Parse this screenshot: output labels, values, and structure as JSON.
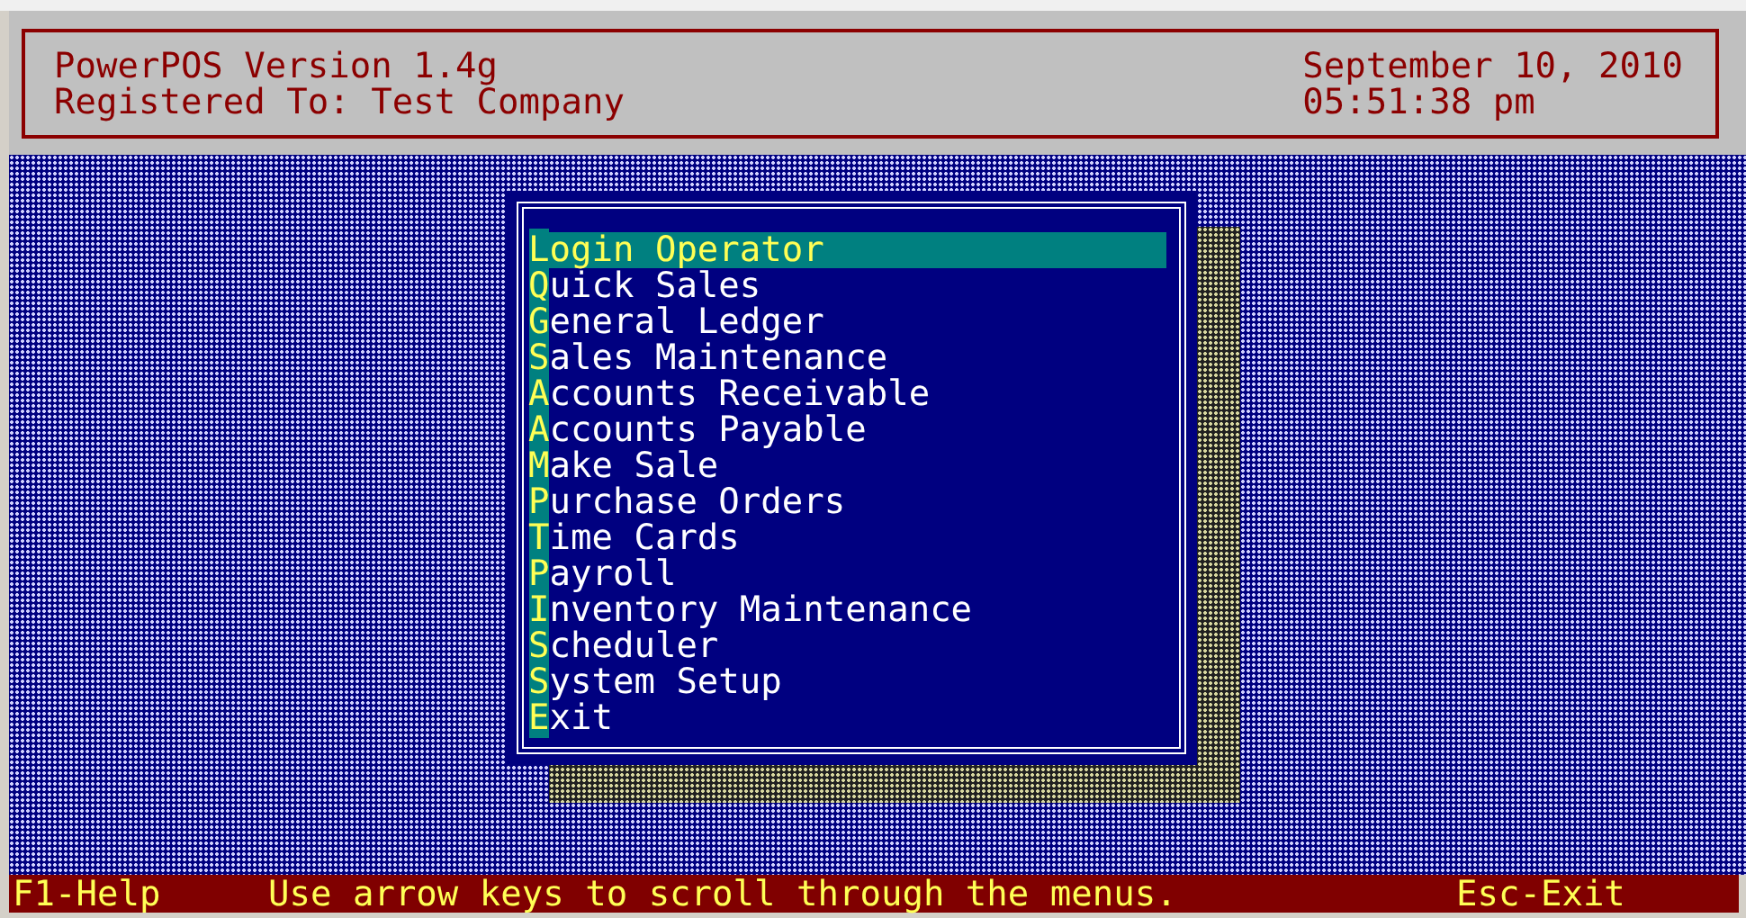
{
  "header": {
    "title": "PowerPOS Version 1.4g",
    "registered": "Registered To: Test Company",
    "date": "September 10, 2010",
    "time": "05:51:38 pm"
  },
  "menu": {
    "items": [
      {
        "label": "Login Operator",
        "selected": true
      },
      {
        "label": "Quick Sales",
        "selected": false
      },
      {
        "label": "General Ledger",
        "selected": false
      },
      {
        "label": "Sales Maintenance",
        "selected": false
      },
      {
        "label": "Accounts Receivable",
        "selected": false
      },
      {
        "label": "Accounts Payable",
        "selected": false
      },
      {
        "label": "Make Sale",
        "selected": false
      },
      {
        "label": "Purchase Orders",
        "selected": false
      },
      {
        "label": "Time Cards",
        "selected": false
      },
      {
        "label": "Payroll",
        "selected": false
      },
      {
        "label": "Inventory Maintenance",
        "selected": false
      },
      {
        "label": "Scheduler",
        "selected": false
      },
      {
        "label": "System Setup",
        "selected": false
      },
      {
        "label": "Exit",
        "selected": false
      }
    ]
  },
  "status_bar": {
    "help": "F1-Help",
    "hint": "Use arrow keys to scroll through the menus.",
    "exit": "Esc-Exit"
  }
}
